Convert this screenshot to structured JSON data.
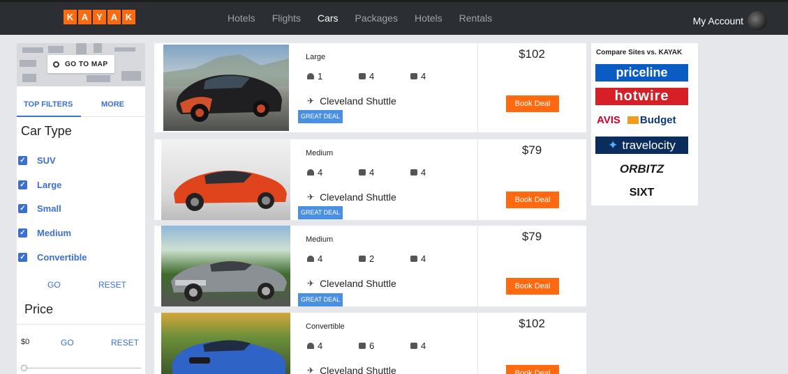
{
  "header": {
    "logo_letters": [
      "K",
      "A",
      "Y",
      "A",
      "K"
    ],
    "nav": [
      "Hotels",
      "Flights",
      "Cars",
      "Packages",
      "Hotels",
      "Rentals"
    ],
    "active_nav": "Cars",
    "account_label": "My Account"
  },
  "sidebar": {
    "map_button": "GO TO MAP",
    "tabs": {
      "top": "TOP FILTERS",
      "more": "MORE"
    },
    "car_type_title": "Car Type",
    "car_types": [
      "SUV",
      "Large",
      "Small",
      "Medium",
      "Convertible"
    ],
    "go": "GO",
    "reset": "RESET",
    "price_title": "Price",
    "price_value": "$0",
    "price_go": "GO",
    "price_reset": "RESET"
  },
  "results": [
    {
      "size": "Large",
      "passengers": "1",
      "bags": "4",
      "doors": "4",
      "location": "Cleveland Shuttle",
      "badge": "GREAT DEAL",
      "price": "$102",
      "cta": "Book Deal"
    },
    {
      "size": "Medium",
      "passengers": "4",
      "bags": "4",
      "doors": "4",
      "location": "Cleveland Shuttle",
      "badge": "GREAT DEAL",
      "price": "$79",
      "cta": "Book Deal"
    },
    {
      "size": "Medium",
      "passengers": "4",
      "bags": "2",
      "doors": "4",
      "location": "Cleveland Shuttle",
      "badge": "GREAT DEAL",
      "price": "$79",
      "cta": "Book Deal"
    },
    {
      "size": "Convertible",
      "passengers": "4",
      "bags": "6",
      "doors": "4",
      "location": "Cleveland Shuttle",
      "badge": "",
      "price": "$102",
      "cta": "Book Deal"
    }
  ],
  "compare": {
    "title": "Compare Sites vs. KAYAK",
    "sites": [
      "priceline",
      "hotwire",
      "AVIS",
      "Budget",
      "travelocity",
      "ORBITZ",
      "SIXT"
    ]
  },
  "colors": {
    "accent": "#ff690f",
    "link": "#3b6fd1",
    "nav_bg": "#2b2f33",
    "badge": "#4a90e2"
  }
}
